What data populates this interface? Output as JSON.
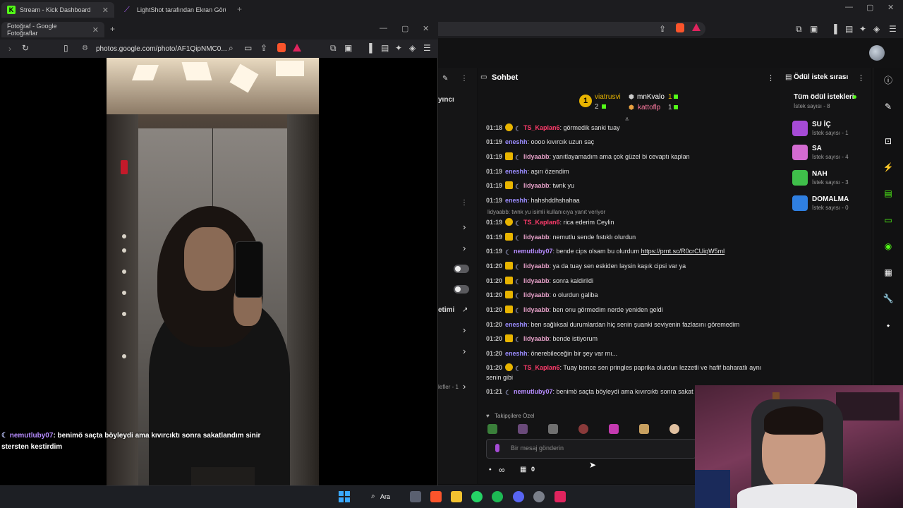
{
  "back_browser": {
    "tabs": [
      {
        "label": "Stream - Kick Dashboard",
        "active": true
      },
      {
        "label": "LightShot tarafından Ekran Görüntüsü",
        "active": false
      }
    ]
  },
  "front_browser": {
    "tab_label": "Fotoğraf - Google Fotoğraflar",
    "url": "photos.google.com/photo/AF1QipNMC0..."
  },
  "photo_overlay": {
    "username": "nemutluby07",
    "text": ": benimö saçta böyleydi ama kıvırcıktı sonra sakatlandım sinir stersten kestirdim"
  },
  "left_panel": {
    "label_top": "yıncı",
    "label_mid": "etimi",
    "label_bottom": "lefler - 1"
  },
  "chat": {
    "title": "Sohbet",
    "top_gifters": [
      {
        "rank": "1",
        "name": "viatrusvi",
        "count": "2"
      },
      {
        "name": "mnKvalo",
        "count": "1"
      },
      {
        "name": "kattoflp",
        "count": "1"
      }
    ],
    "messages": [
      {
        "time": "01:18",
        "badges": [
          "one",
          "moon"
        ],
        "user": "TS_Kaplan6",
        "cls": "u-ts",
        "text": ": görmedik sanki tuay"
      },
      {
        "time": "01:19",
        "badges": [],
        "user": "eneshh",
        "cls": "u-enes",
        "text": ": oooo kıvırcık uzun saç"
      },
      {
        "time": "01:19",
        "badges": [
          "crown",
          "moon"
        ],
        "user": "lidyaabb",
        "cls": "u-lidya",
        "text": ": yanıtlayamadım ama çok güzel bi cevaptı kaplan"
      },
      {
        "time": "01:19",
        "badges": [],
        "user": "eneshh",
        "cls": "u-enes",
        "text": ": aşırı özendim"
      },
      {
        "time": "01:19",
        "badges": [
          "crown",
          "moon"
        ],
        "user": "lidyaabb",
        "cls": "u-lidya",
        "text": ": twnk yu"
      },
      {
        "time": "01:19",
        "badges": [],
        "user": "eneshh",
        "cls": "u-enes",
        "text": ": hahshddhshahaa"
      },
      {
        "time": "01:19",
        "badges": [
          "one",
          "moon"
        ],
        "user": "TS_Kaplan6",
        "cls": "u-ts",
        "text": ": rica ederim Ceylin"
      },
      {
        "time": "01:19",
        "badges": [
          "crown",
          "moon"
        ],
        "user": "lidyaabb",
        "cls": "u-lidya",
        "text": ": nemutlu sende fıstıklı olurdun"
      },
      {
        "time": "01:19",
        "badges": [
          "moon"
        ],
        "user": "nemutluby07",
        "cls": "u-nemut",
        "text": ": bende cips olsam bu olurdum ",
        "link": "https://prnt.sc/R0crCUiqW5ml"
      },
      {
        "time": "01:20",
        "badges": [
          "crown",
          "moon"
        ],
        "user": "lidyaabb",
        "cls": "u-lidya",
        "text": ": ya da tuay sen eskiden laysin kaşık cipsi var ya"
      },
      {
        "time": "01:20",
        "badges": [
          "crown",
          "moon"
        ],
        "user": "lidyaabb",
        "cls": "u-lidya",
        "text": ": sonra kaldirildi"
      },
      {
        "time": "01:20",
        "badges": [
          "crown",
          "moon"
        ],
        "user": "lidyaabb",
        "cls": "u-lidya",
        "text": ": o olurdun galiba"
      },
      {
        "time": "01:20",
        "badges": [
          "crown",
          "moon"
        ],
        "user": "lidyaabb",
        "cls": "u-lidya",
        "text": ": ben onu görmedim nerde yeniden geldi"
      },
      {
        "time": "01:20",
        "badges": [],
        "user": "eneshh",
        "cls": "u-enes",
        "text": ": ben sağlıksal durumlardan hiç senin şuanki seviyenin fazlasını göremedim"
      },
      {
        "time": "01:20",
        "badges": [
          "crown",
          "moon"
        ],
        "user": "lidyaabb",
        "cls": "u-lidya",
        "text": ": bende istiyorum"
      },
      {
        "time": "01:20",
        "badges": [],
        "user": "eneshh",
        "cls": "u-enes",
        "text": ": önerebileceğin bir şey var mı..."
      },
      {
        "time": "01:20",
        "badges": [
          "one",
          "moon"
        ],
        "user": "TS_Kaplan6",
        "cls": "u-ts",
        "text": ": Tuay bence sen pringles paprika olurdun lezzetli ve hafif baharatlı aynı senin gibi"
      },
      {
        "time": "01:21",
        "badges": [
          "moon"
        ],
        "user": "nemutluby07",
        "cls": "u-nemut",
        "text": ": benimö saçta böyleydi ama kıvırcıktı sonra sakat kestirdim"
      }
    ],
    "reply_hint": "lidyaabb: twnk yu isimli kullanıcıya yanıt veriyor",
    "emote_label": "Takipçilere Özel",
    "input_placeholder": "Bir mesaj gönderin",
    "footer_infinity": "∞",
    "footer_count": "0"
  },
  "reward_queue": {
    "title": "Ödül istek sırası",
    "all_label": "Tüm ödül istekleri",
    "all_count": "İstek sayısı - 8",
    "items": [
      {
        "name": "SU İÇ",
        "count": "İstek sayısı - 1",
        "color": "#a64bd6"
      },
      {
        "name": "SA",
        "count": "İstek sayısı - 4",
        "color": "#d36bd0"
      },
      {
        "name": "NAH",
        "count": "İstek sayısı - 3",
        "color": "#3fbf4a"
      },
      {
        "name": "DOMALMA",
        "count": "İstek sayısı - 0",
        "color": "#2f7fe0"
      }
    ]
  },
  "taskbar": {
    "search_label": "Ara"
  },
  "colors": {
    "kick_green": "#53fc18",
    "accent_purple": "#9b8cff"
  }
}
